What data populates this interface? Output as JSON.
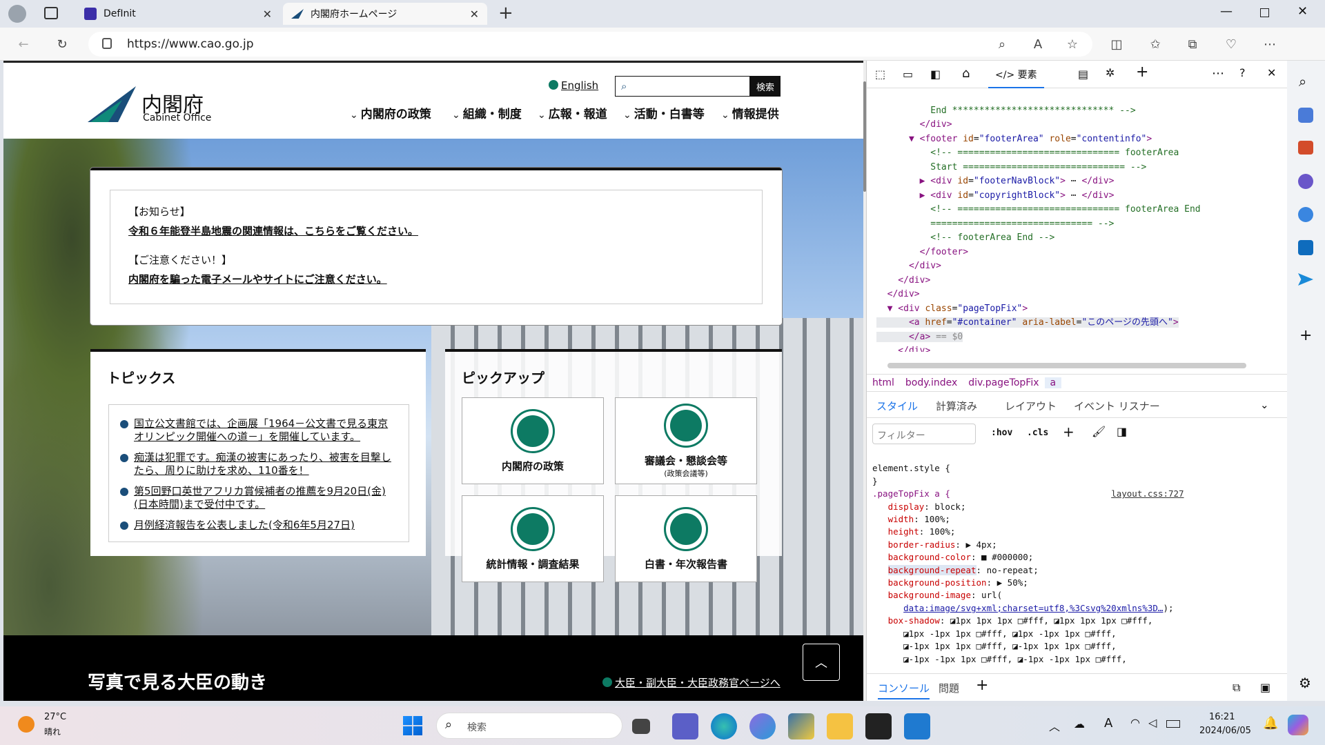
{
  "browser": {
    "tabs": [
      {
        "title": "DefInit"
      },
      {
        "title": "内閣府ホームページ"
      }
    ],
    "url": "https://www.cao.go.jp"
  },
  "site": {
    "logo_jp": "内閣府",
    "logo_en": "Cabinet Office",
    "english_link": "English",
    "search_button": "検索",
    "nav": [
      "内閣府の政策",
      "組織・制度",
      "広報・報道",
      "活動・白書等",
      "情報提供"
    ],
    "notice": {
      "heading1": "【お知らせ】",
      "link1": "令和６年能登半島地震の関連情報は、こちらをご覧ください。",
      "heading2": "【ご注意ください！】",
      "link2": "内閣府を騙った電子メールやサイトにご注意ください。"
    },
    "topics": {
      "title": "トピックス",
      "items": [
        "国立公文書館では、企画展「1964－公文書で見る東京オリンピック開催への道－」を開催しています。",
        "痴漢は犯罪です。痴漢の被害にあったり、被害を目撃したら、周りに助けを求め、110番を！",
        "第5回野口英世アフリカ賞候補者の推薦を9月20日(金)(日本時間)まで受付中です。",
        "月例経済報告を公表しました(令和6年5月27日)"
      ]
    },
    "pickup": {
      "title": "ピックアップ",
      "items": [
        {
          "label": "内閣府の政策",
          "sub": ""
        },
        {
          "label": "審議会・懇談会等",
          "sub": "(政策会議等)"
        },
        {
          "label": "統計情報・調査結果",
          "sub": ""
        },
        {
          "label": "白書・年次報告書",
          "sub": ""
        }
      ]
    },
    "minister_heading": "写真で見る大臣の動き",
    "minister_link": "大臣・副大臣・大臣政務官ページへ"
  },
  "devtools": {
    "active_tab": "要素",
    "breadcrumbs": [
      "html",
      "body.index",
      "div.pageTopFix",
      "a"
    ],
    "style_tabs": [
      "スタイル",
      "計算済み",
      "レイアウト",
      "イベント リスナー"
    ],
    "filter_placeholder": "フィルター",
    "hov": ":hov",
    "cls": ".cls",
    "element_style": "element.style {",
    "rule_selector": ".pageTopFix a {",
    "rule_source": "layout.css:727",
    "drawer_tabs": [
      "コンソール",
      "問題"
    ]
  },
  "taskbar": {
    "temperature": "27°C",
    "weather": "晴れ",
    "search_placeholder": "検索",
    "time": "16:21",
    "date": "2024/06/05"
  },
  "colors": {
    "accent": "#0d7a63",
    "brand_blue": "#1a4e7a",
    "devtools_tag": "#881280"
  }
}
